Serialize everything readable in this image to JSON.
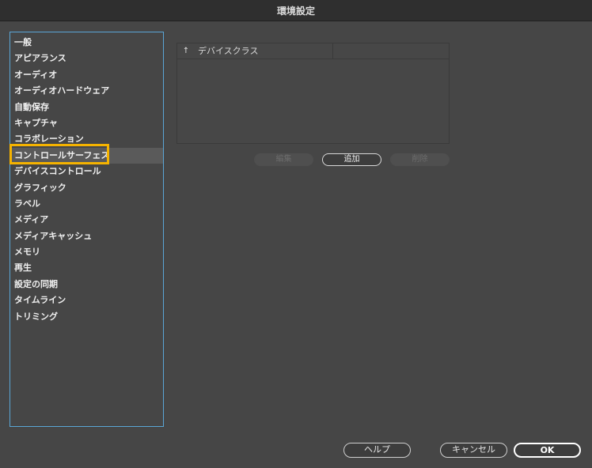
{
  "window": {
    "title": "環境設定"
  },
  "sidebar": {
    "items": [
      {
        "label": "一般"
      },
      {
        "label": "アピアランス"
      },
      {
        "label": "オーディオ"
      },
      {
        "label": "オーディオハードウェア"
      },
      {
        "label": "自動保存"
      },
      {
        "label": "キャプチャ"
      },
      {
        "label": "コラボレーション"
      },
      {
        "label": "コントロールサーフェス",
        "selected": true
      },
      {
        "label": "デバイスコントロール"
      },
      {
        "label": "グラフィック"
      },
      {
        "label": "ラベル"
      },
      {
        "label": "メディア"
      },
      {
        "label": "メディアキャッシュ"
      },
      {
        "label": "メモリ"
      },
      {
        "label": "再生"
      },
      {
        "label": "設定の同期"
      },
      {
        "label": "タイムライン"
      },
      {
        "label": "トリミング"
      }
    ]
  },
  "device_table": {
    "sort_icon": "arrow-up-icon",
    "columns": [
      "デバイスクラス"
    ],
    "rows": []
  },
  "table_buttons": {
    "edit_label": "編集",
    "add_label": "追加",
    "delete_label": "削除"
  },
  "footer": {
    "help_label": "ヘルプ",
    "cancel_label": "キャンセル",
    "ok_label": "OK"
  },
  "colors": {
    "highlight": "#f5b300",
    "focus_border": "#5aa6d6"
  }
}
